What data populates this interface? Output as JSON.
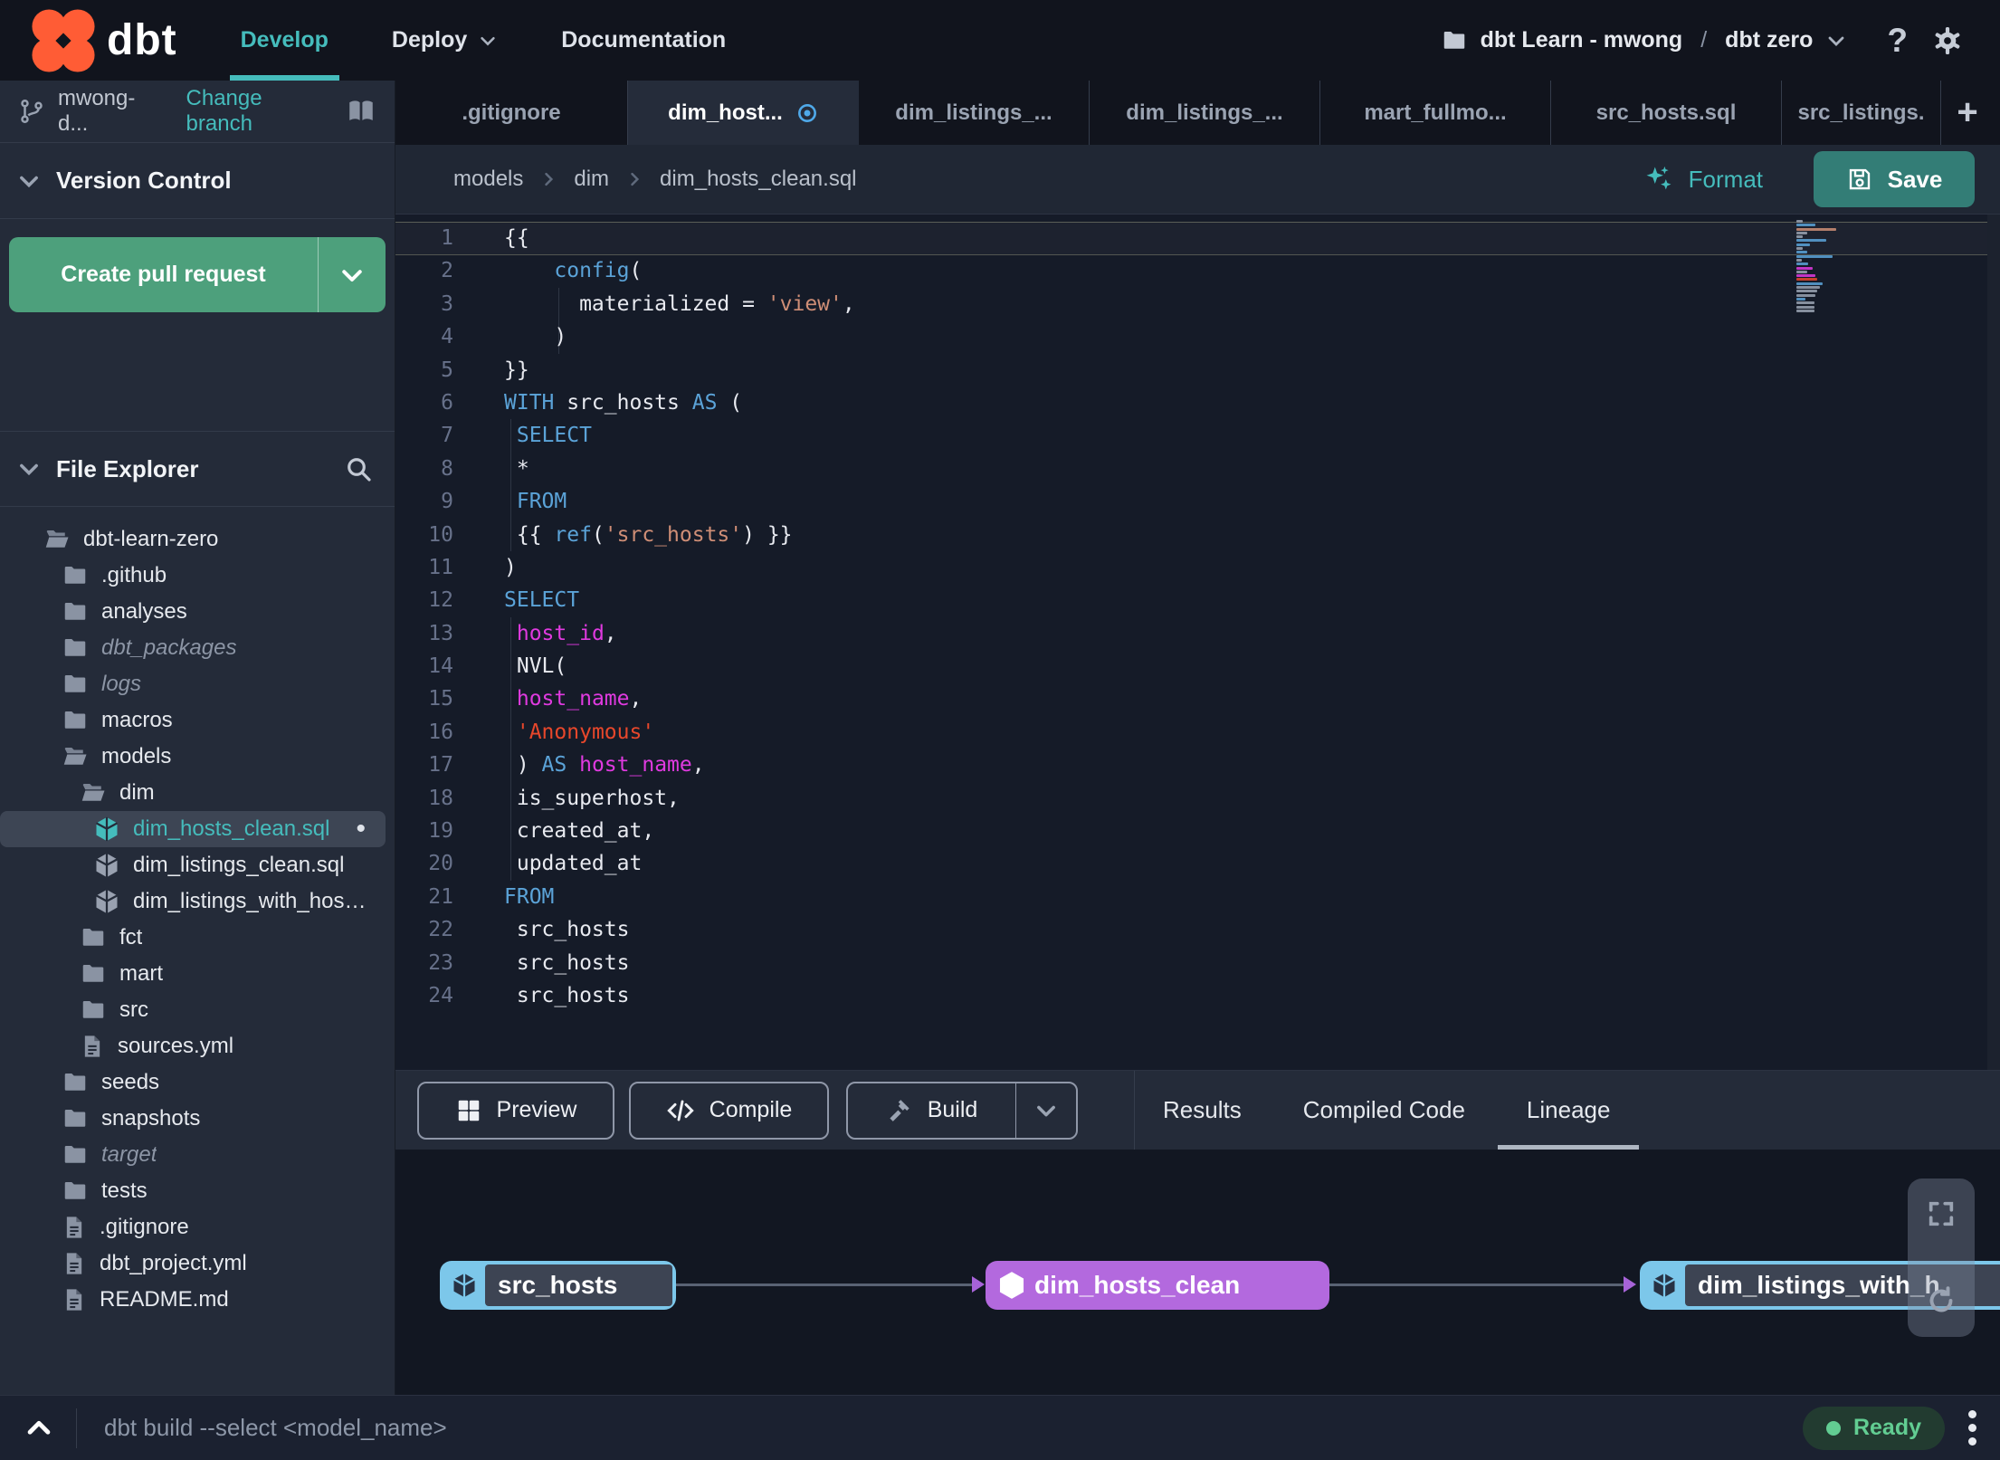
{
  "navbar": {
    "logo_text": "dbt",
    "develop": "Develop",
    "deploy": "Deploy",
    "documentation": "Documentation",
    "project_label": "dbt Learn - mwong",
    "separator": "/",
    "environment": "dbt zero",
    "help": "?"
  },
  "sidebar": {
    "branch": {
      "name": "mwong-d...",
      "change": "Change branch"
    },
    "version_control": {
      "title": "Version Control",
      "create_pr": "Create pull request"
    },
    "file_explorer": {
      "title": "File Explorer"
    },
    "tree": [
      {
        "label": "dbt-learn-zero",
        "icon": "folder-open",
        "depth": 0
      },
      {
        "label": ".github",
        "icon": "folder",
        "depth": 1
      },
      {
        "label": "analyses",
        "icon": "folder",
        "depth": 1
      },
      {
        "label": "dbt_packages",
        "icon": "folder",
        "depth": 1,
        "italic": true
      },
      {
        "label": "logs",
        "icon": "folder",
        "depth": 1,
        "italic": true
      },
      {
        "label": "macros",
        "icon": "folder",
        "depth": 1
      },
      {
        "label": "models",
        "icon": "folder-open",
        "depth": 1
      },
      {
        "label": "dim",
        "icon": "folder-open",
        "depth": 2
      },
      {
        "label": "dim_hosts_clean.sql",
        "icon": "model",
        "depth": 3,
        "selected": true,
        "modified": true
      },
      {
        "label": "dim_listings_clean.sql",
        "icon": "model",
        "depth": 3
      },
      {
        "label": "dim_listings_with_hosts...",
        "icon": "model",
        "depth": 3
      },
      {
        "label": "fct",
        "icon": "folder",
        "depth": 2
      },
      {
        "label": "mart",
        "icon": "folder",
        "depth": 2
      },
      {
        "label": "src",
        "icon": "folder",
        "depth": 2
      },
      {
        "label": "sources.yml",
        "icon": "file",
        "depth": 2
      },
      {
        "label": "seeds",
        "icon": "folder",
        "depth": 1
      },
      {
        "label": "snapshots",
        "icon": "folder",
        "depth": 1
      },
      {
        "label": "target",
        "icon": "folder",
        "depth": 1,
        "italic": true
      },
      {
        "label": "tests",
        "icon": "folder",
        "depth": 1
      },
      {
        "label": ".gitignore",
        "icon": "file",
        "depth": 1
      },
      {
        "label": "dbt_project.yml",
        "icon": "file",
        "depth": 1
      },
      {
        "label": "README.md",
        "icon": "file",
        "depth": 1
      }
    ]
  },
  "tabs": {
    "items": [
      {
        "label": ".gitignore"
      },
      {
        "label": "dim_host...",
        "modified": true
      },
      {
        "label": "dim_listings_..."
      },
      {
        "label": "dim_listings_..."
      },
      {
        "label": "mart_fullmo..."
      },
      {
        "label": "src_hosts.sql"
      },
      {
        "label": "src_listings."
      }
    ],
    "active_index": 1,
    "plus": "+"
  },
  "breadcrumb": {
    "parts": [
      "models",
      "dim",
      "dim_hosts_clean.sql"
    ],
    "format": "Format",
    "save": "Save"
  },
  "editor": {
    "active_line": 1,
    "lines": [
      [
        [
          "p",
          "{{"
        ]
      ],
      [
        [
          "p",
          "    "
        ],
        [
          "k",
          "config"
        ],
        [
          "p",
          "("
        ]
      ],
      [
        [
          "p",
          "      materialized = "
        ],
        [
          "s",
          "'view'"
        ],
        [
          "p",
          ","
        ]
      ],
      [
        [
          "p",
          "    )"
        ]
      ],
      [
        [
          "p",
          "}}"
        ]
      ],
      [
        [
          "k",
          "WITH"
        ],
        [
          "p",
          " src_hosts "
        ],
        [
          "k",
          "AS"
        ],
        [
          "p",
          " ("
        ]
      ],
      [
        [
          "p",
          " "
        ],
        [
          "k",
          "SELECT"
        ]
      ],
      [
        [
          "p",
          " *"
        ]
      ],
      [
        [
          "p",
          " "
        ],
        [
          "k",
          "FROM"
        ]
      ],
      [
        [
          "p",
          " {{ "
        ],
        [
          "k",
          "ref"
        ],
        [
          "p",
          "("
        ],
        [
          "s",
          "'src_hosts'"
        ],
        [
          "p",
          ") }}"
        ]
      ],
      [
        [
          "p",
          ")"
        ]
      ],
      [
        [
          "k",
          "SELECT"
        ]
      ],
      [
        [
          "p",
          " "
        ],
        [
          "m",
          "host_id"
        ],
        [
          "p",
          ","
        ]
      ],
      [
        [
          "p",
          " NVL("
        ]
      ],
      [
        [
          "p",
          " "
        ],
        [
          "m",
          "host_name"
        ],
        [
          "p",
          ","
        ]
      ],
      [
        [
          "p",
          " "
        ],
        [
          "r",
          "'Anonymous'"
        ]
      ],
      [
        [
          "p",
          " ) "
        ],
        [
          "k",
          "AS"
        ],
        [
          "p",
          " "
        ],
        [
          "m",
          "host_name"
        ],
        [
          "p",
          ","
        ]
      ],
      [
        [
          "p",
          " is_superhost,"
        ]
      ],
      [
        [
          "p",
          " created_at,"
        ]
      ],
      [
        [
          "p",
          " updated_at"
        ]
      ],
      [
        [
          "k",
          "FROM"
        ]
      ],
      [
        [
          "p",
          " src_hosts"
        ]
      ],
      [
        [
          "p",
          " src_hosts"
        ]
      ],
      [
        [
          "p",
          " src_hosts"
        ]
      ]
    ]
  },
  "toolbar": {
    "preview": "Preview",
    "compile": "Compile",
    "build": "Build",
    "tabs": [
      "Results",
      "Compiled Code",
      "Lineage"
    ],
    "active_tab": "Lineage"
  },
  "lineage": {
    "nodes": [
      {
        "label": "src_hosts",
        "style": "blue"
      },
      {
        "label": "dim_hosts_clean",
        "style": "purple"
      },
      {
        "label": "dim_listings_with_h",
        "style": "blue"
      }
    ]
  },
  "command_bar": {
    "placeholder": "dbt build --select <model_name>",
    "status": "Ready"
  },
  "colors": {
    "accent_teal": "#45bcbc",
    "create_pr_green": "#4da07c",
    "save_teal": "#337d76",
    "status_green": "#62cd92",
    "code_keyword": "#5ba3d8",
    "code_string": "#cf8e76",
    "code_red": "#e8472b",
    "code_magenta": "#e03ae0",
    "code_plain": "#e8eaf0",
    "node_blue": "#7cc7ea",
    "node_purple": "#b369de",
    "modified_dot_blue": "#4fa9e9"
  }
}
